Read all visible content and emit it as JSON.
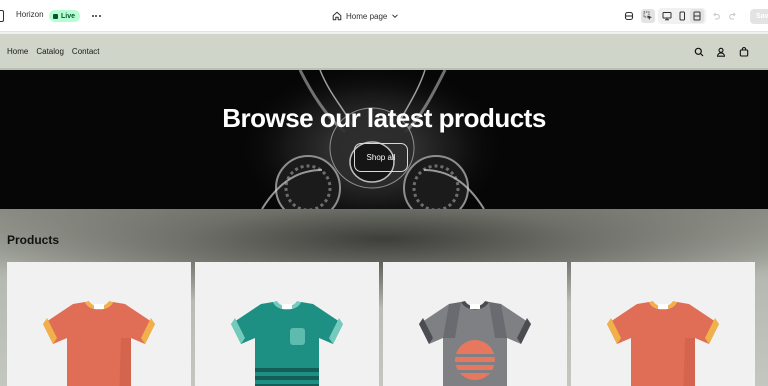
{
  "editor": {
    "store_name": "Horizon",
    "status_badge": "Live",
    "page_selector": "Home page",
    "save_label": "Save"
  },
  "storefront": {
    "nav": [
      {
        "label": "Home"
      },
      {
        "label": "Catalog"
      },
      {
        "label": "Contact"
      }
    ],
    "hero": {
      "title": "Browse our latest products",
      "button_label": "Shop all"
    },
    "products": {
      "heading": "Products",
      "items": [
        {
          "shirt_color": "#e06e57",
          "trim_color": "#f0b04a",
          "style": "plain"
        },
        {
          "shirt_color": "#1d8f83",
          "trim_color": "#74cbbd",
          "style": "pocket-stripes"
        },
        {
          "shirt_color": "#7e8084",
          "trim_color": "#4a4c52",
          "style": "sunset-graphic"
        },
        {
          "shirt_color": "#e06e57",
          "trim_color": "#f0b04a",
          "style": "plain"
        }
      ]
    }
  },
  "colors": {
    "header_bg": "#cfd5c8",
    "live_badge_bg": "#b4fed2",
    "hero_bg": "#060606"
  }
}
